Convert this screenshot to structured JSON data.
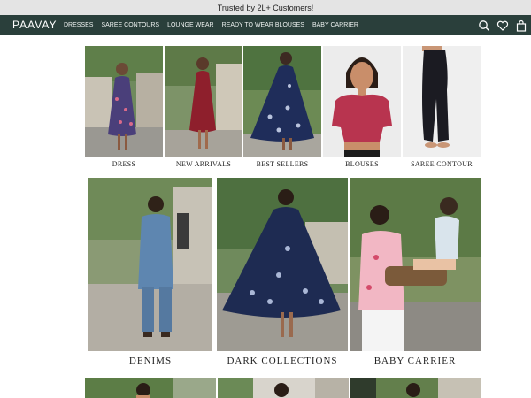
{
  "announcement": {
    "text": "Trusted by 2L+ Customers!"
  },
  "header": {
    "logo": "PAAVAY",
    "menu": [
      "DRESSES",
      "SAREE CONTOURS",
      "LOUNGE WEAR",
      "READY TO WEAR BLOUSES",
      "BABY CARRIER"
    ],
    "icons": [
      "search-icon",
      "heart-icon",
      "cart-icon"
    ]
  },
  "categories_row1": [
    {
      "label": "DRESS"
    },
    {
      "label": "NEW ARRIVALS"
    },
    {
      "label": "BEST SELLERS"
    },
    {
      "label": "BLOUSES"
    },
    {
      "label": "SAREE CONTOUR"
    }
  ],
  "categories_row2": [
    {
      "label": "DENIMS"
    },
    {
      "label": "DARK COLLECTIONS"
    },
    {
      "label": "BABY CARRIER"
    }
  ],
  "colors": {
    "nav_bg": "#2a3f3b",
    "announce_bg": "#e4e4e4"
  }
}
